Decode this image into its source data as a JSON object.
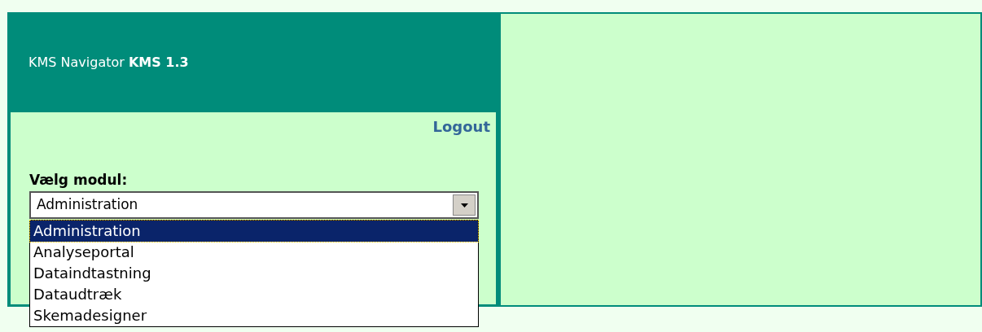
{
  "header": {
    "title": "KMS Navigator **KMS 1.3**"
  },
  "logout_link": "Logout",
  "module_select": {
    "label": "Vælg modul:",
    "value": "Administration",
    "expanded": true,
    "options": [
      {
        "label": "Administration",
        "selected": true
      },
      {
        "label": "Analyseportal",
        "selected": false
      },
      {
        "label": "Dataindtastning",
        "selected": false
      },
      {
        "label": "Dataudtræk",
        "selected": false
      },
      {
        "label": "Skemadesigner",
        "selected": false
      }
    ]
  }
}
